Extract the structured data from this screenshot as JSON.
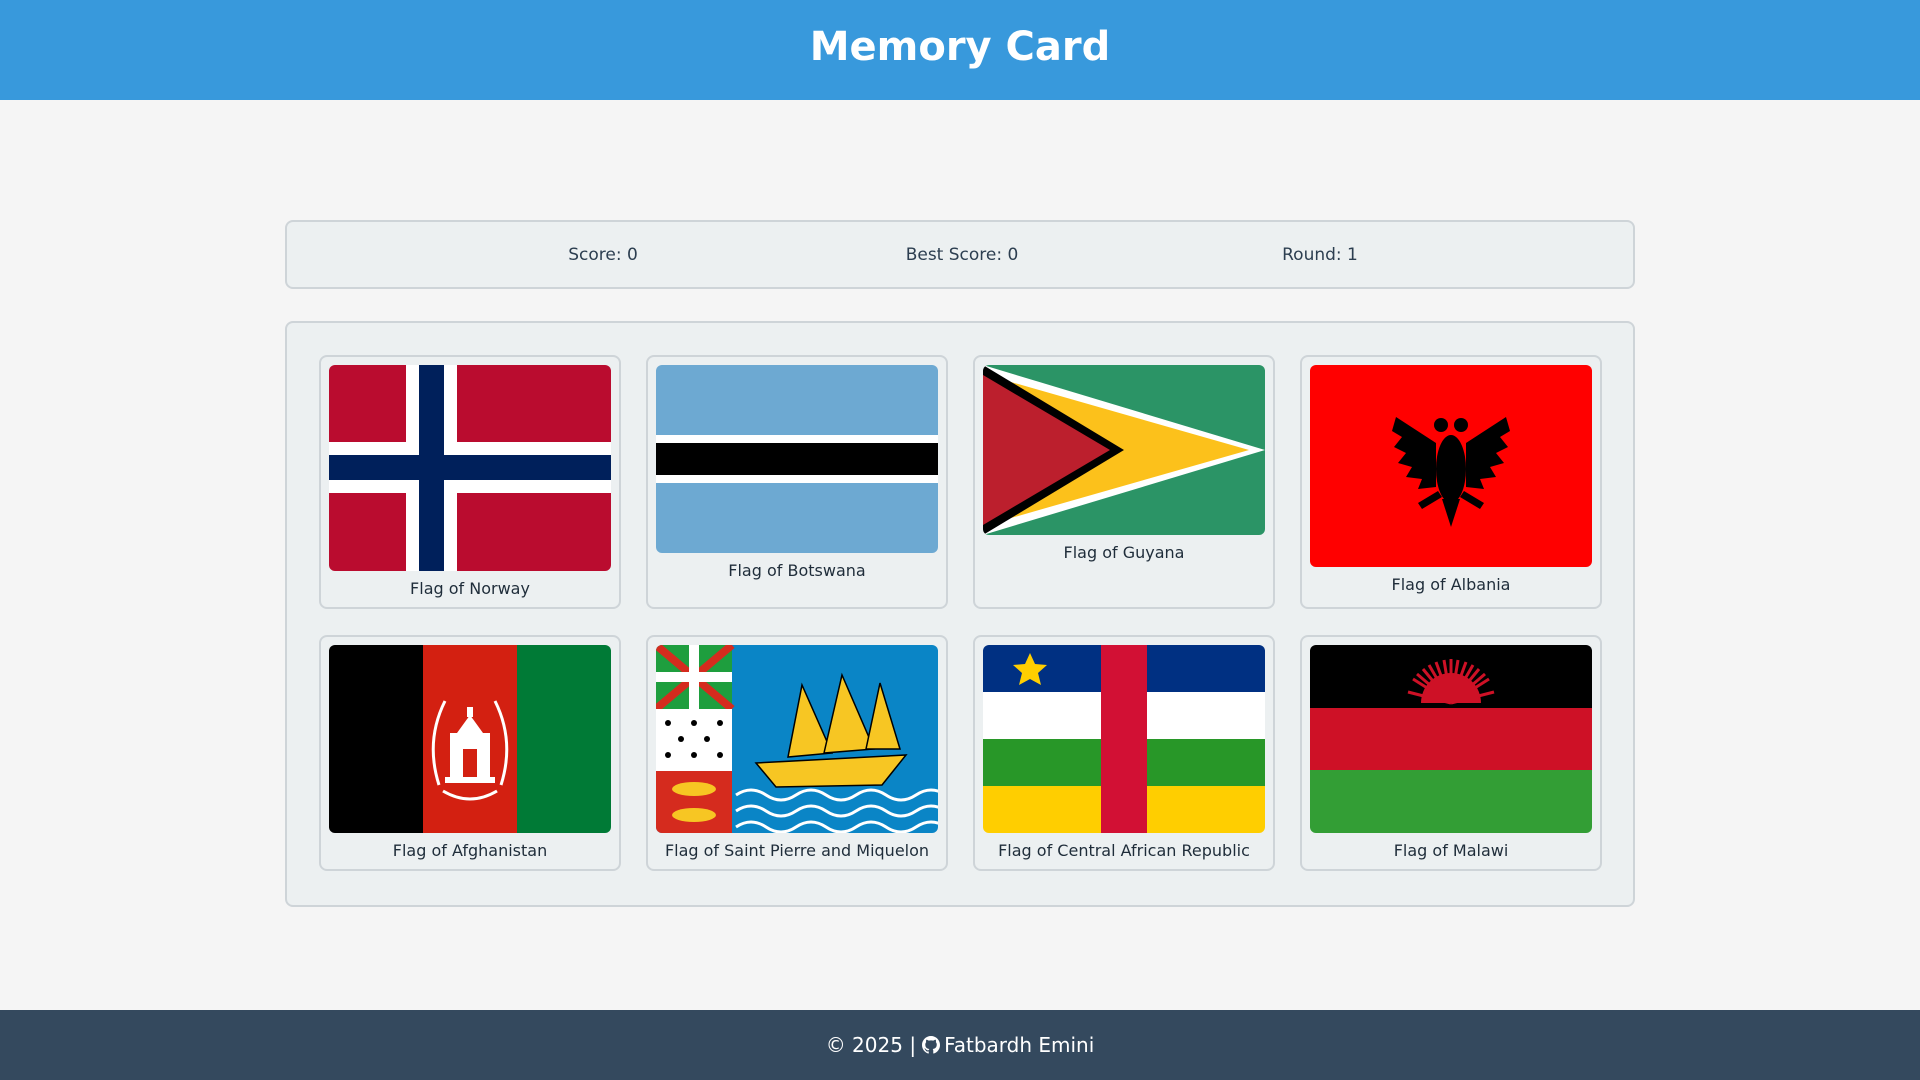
{
  "header": {
    "title": "Memory Card"
  },
  "scoreboard": {
    "score": "Score: 0",
    "best_score": "Best Score: 0",
    "round": "Round: 1"
  },
  "cards": [
    {
      "label": "Flag of Norway",
      "icon": "norway-flag-icon"
    },
    {
      "label": "Flag of Botswana",
      "icon": "botswana-flag-icon"
    },
    {
      "label": "Flag of Guyana",
      "icon": "guyana-flag-icon"
    },
    {
      "label": "Flag of Albania",
      "icon": "albania-flag-icon"
    },
    {
      "label": "Flag of Afghanistan",
      "icon": "afghanistan-flag-icon"
    },
    {
      "label": "Flag of Saint Pierre and Miquelon",
      "icon": "saint-pierre-and-miquelon-flag-icon"
    },
    {
      "label": "Flag of Central African Republic",
      "icon": "central-african-republic-flag-icon"
    },
    {
      "label": "Flag of Malawi",
      "icon": "malawi-flag-icon"
    }
  ],
  "footer": {
    "copyright": "© 2025 |",
    "author": "Fatbardh Emini",
    "icon": "github-icon"
  },
  "colors": {
    "header_bg": "#3899dc",
    "footer_bg": "#34495e",
    "page_bg": "#f5f5f5",
    "panel_bg": "#ecf0f1"
  }
}
